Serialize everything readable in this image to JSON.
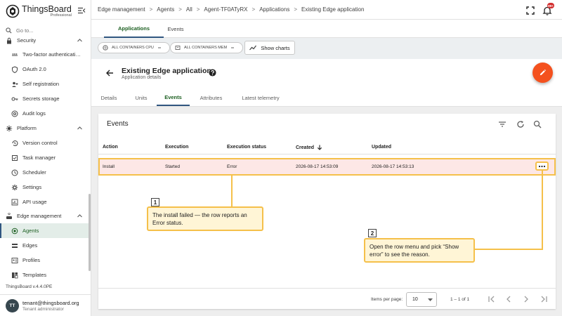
{
  "app": {
    "brand": "ThingsBoard",
    "brand_sub": "Professional",
    "goto_placeholder": "Go to...",
    "version": "ThingsBoard v.4.4.0PE"
  },
  "user": {
    "initials": "TT",
    "email": "tenant@thingsboard.org",
    "role": "Tenant administrator"
  },
  "sidebar": {
    "items": [
      {
        "label": "Security",
        "icon": "lock-icon",
        "section": true
      },
      {
        "label": "Two-factor authenticati…",
        "icon": "password-icon"
      },
      {
        "label": "OAuth 2.0",
        "icon": "shield-icon"
      },
      {
        "label": "Self registration",
        "icon": "person-add-icon"
      },
      {
        "label": "Secrets storage",
        "icon": "key-icon"
      },
      {
        "label": "Audit logs",
        "icon": "track-changes-icon"
      },
      {
        "label": "Platform",
        "icon": "settings-applications-icon",
        "section": true
      },
      {
        "label": "Version control",
        "icon": "history-icon"
      },
      {
        "label": "Task manager",
        "icon": "task-icon"
      },
      {
        "label": "Scheduler",
        "icon": "schedule-icon"
      },
      {
        "label": "Settings",
        "icon": "gear-icon"
      },
      {
        "label": "API usage",
        "icon": "insert-chart-icon"
      },
      {
        "label": "Edge management",
        "icon": "router-icon",
        "section": true
      },
      {
        "label": "Agents",
        "icon": "agent-icon",
        "active": true
      },
      {
        "label": "Edges",
        "icon": "edge-icon"
      },
      {
        "label": "Profiles",
        "icon": "profile-icon"
      },
      {
        "label": "Templates",
        "icon": "template-icon"
      }
    ]
  },
  "breadcrumb": [
    "Edge management",
    "Agents",
    "All",
    "Agent-TF0ATyRX",
    "Applications",
    "Existing Edge application"
  ],
  "notifications": {
    "badge": "99+"
  },
  "top_tabs": [
    "Applications",
    "Events"
  ],
  "chips": {
    "cpu": "ALL CONTAINERS CPU",
    "mem": "ALL CONTAINERS MEM",
    "show_charts": "Show charts"
  },
  "details": {
    "title": "Existing Edge application",
    "subtitle": "Application details",
    "tabs": [
      "Details",
      "Units",
      "Events",
      "Attributes",
      "Latest telemetry"
    ],
    "active_tab": "Events"
  },
  "events": {
    "title": "Events",
    "columns": [
      "Action",
      "Execution",
      "Execution status",
      "Created",
      "Updated"
    ],
    "rows": [
      {
        "action": "Install",
        "execution": "Started",
        "status": "Error",
        "created": "2026-08-17 14:53:09",
        "updated": "2026-08-17 14:53:13"
      }
    ],
    "items_per_page_label": "Items per page:",
    "items_per_page": "10",
    "range": "1 – 1 of 1"
  },
  "annotations": [
    {
      "num": "1",
      "text": "The install failed — the row reports an Error status."
    },
    {
      "num": "2",
      "text": "Open the row menu and pick “Show error” to see the reason."
    }
  ],
  "colors": {
    "accent": "#305680",
    "active_text": "#1b5e20",
    "fab": "#f4511e",
    "highlight": "#f5c04a",
    "error_row": "#fde7e6"
  }
}
